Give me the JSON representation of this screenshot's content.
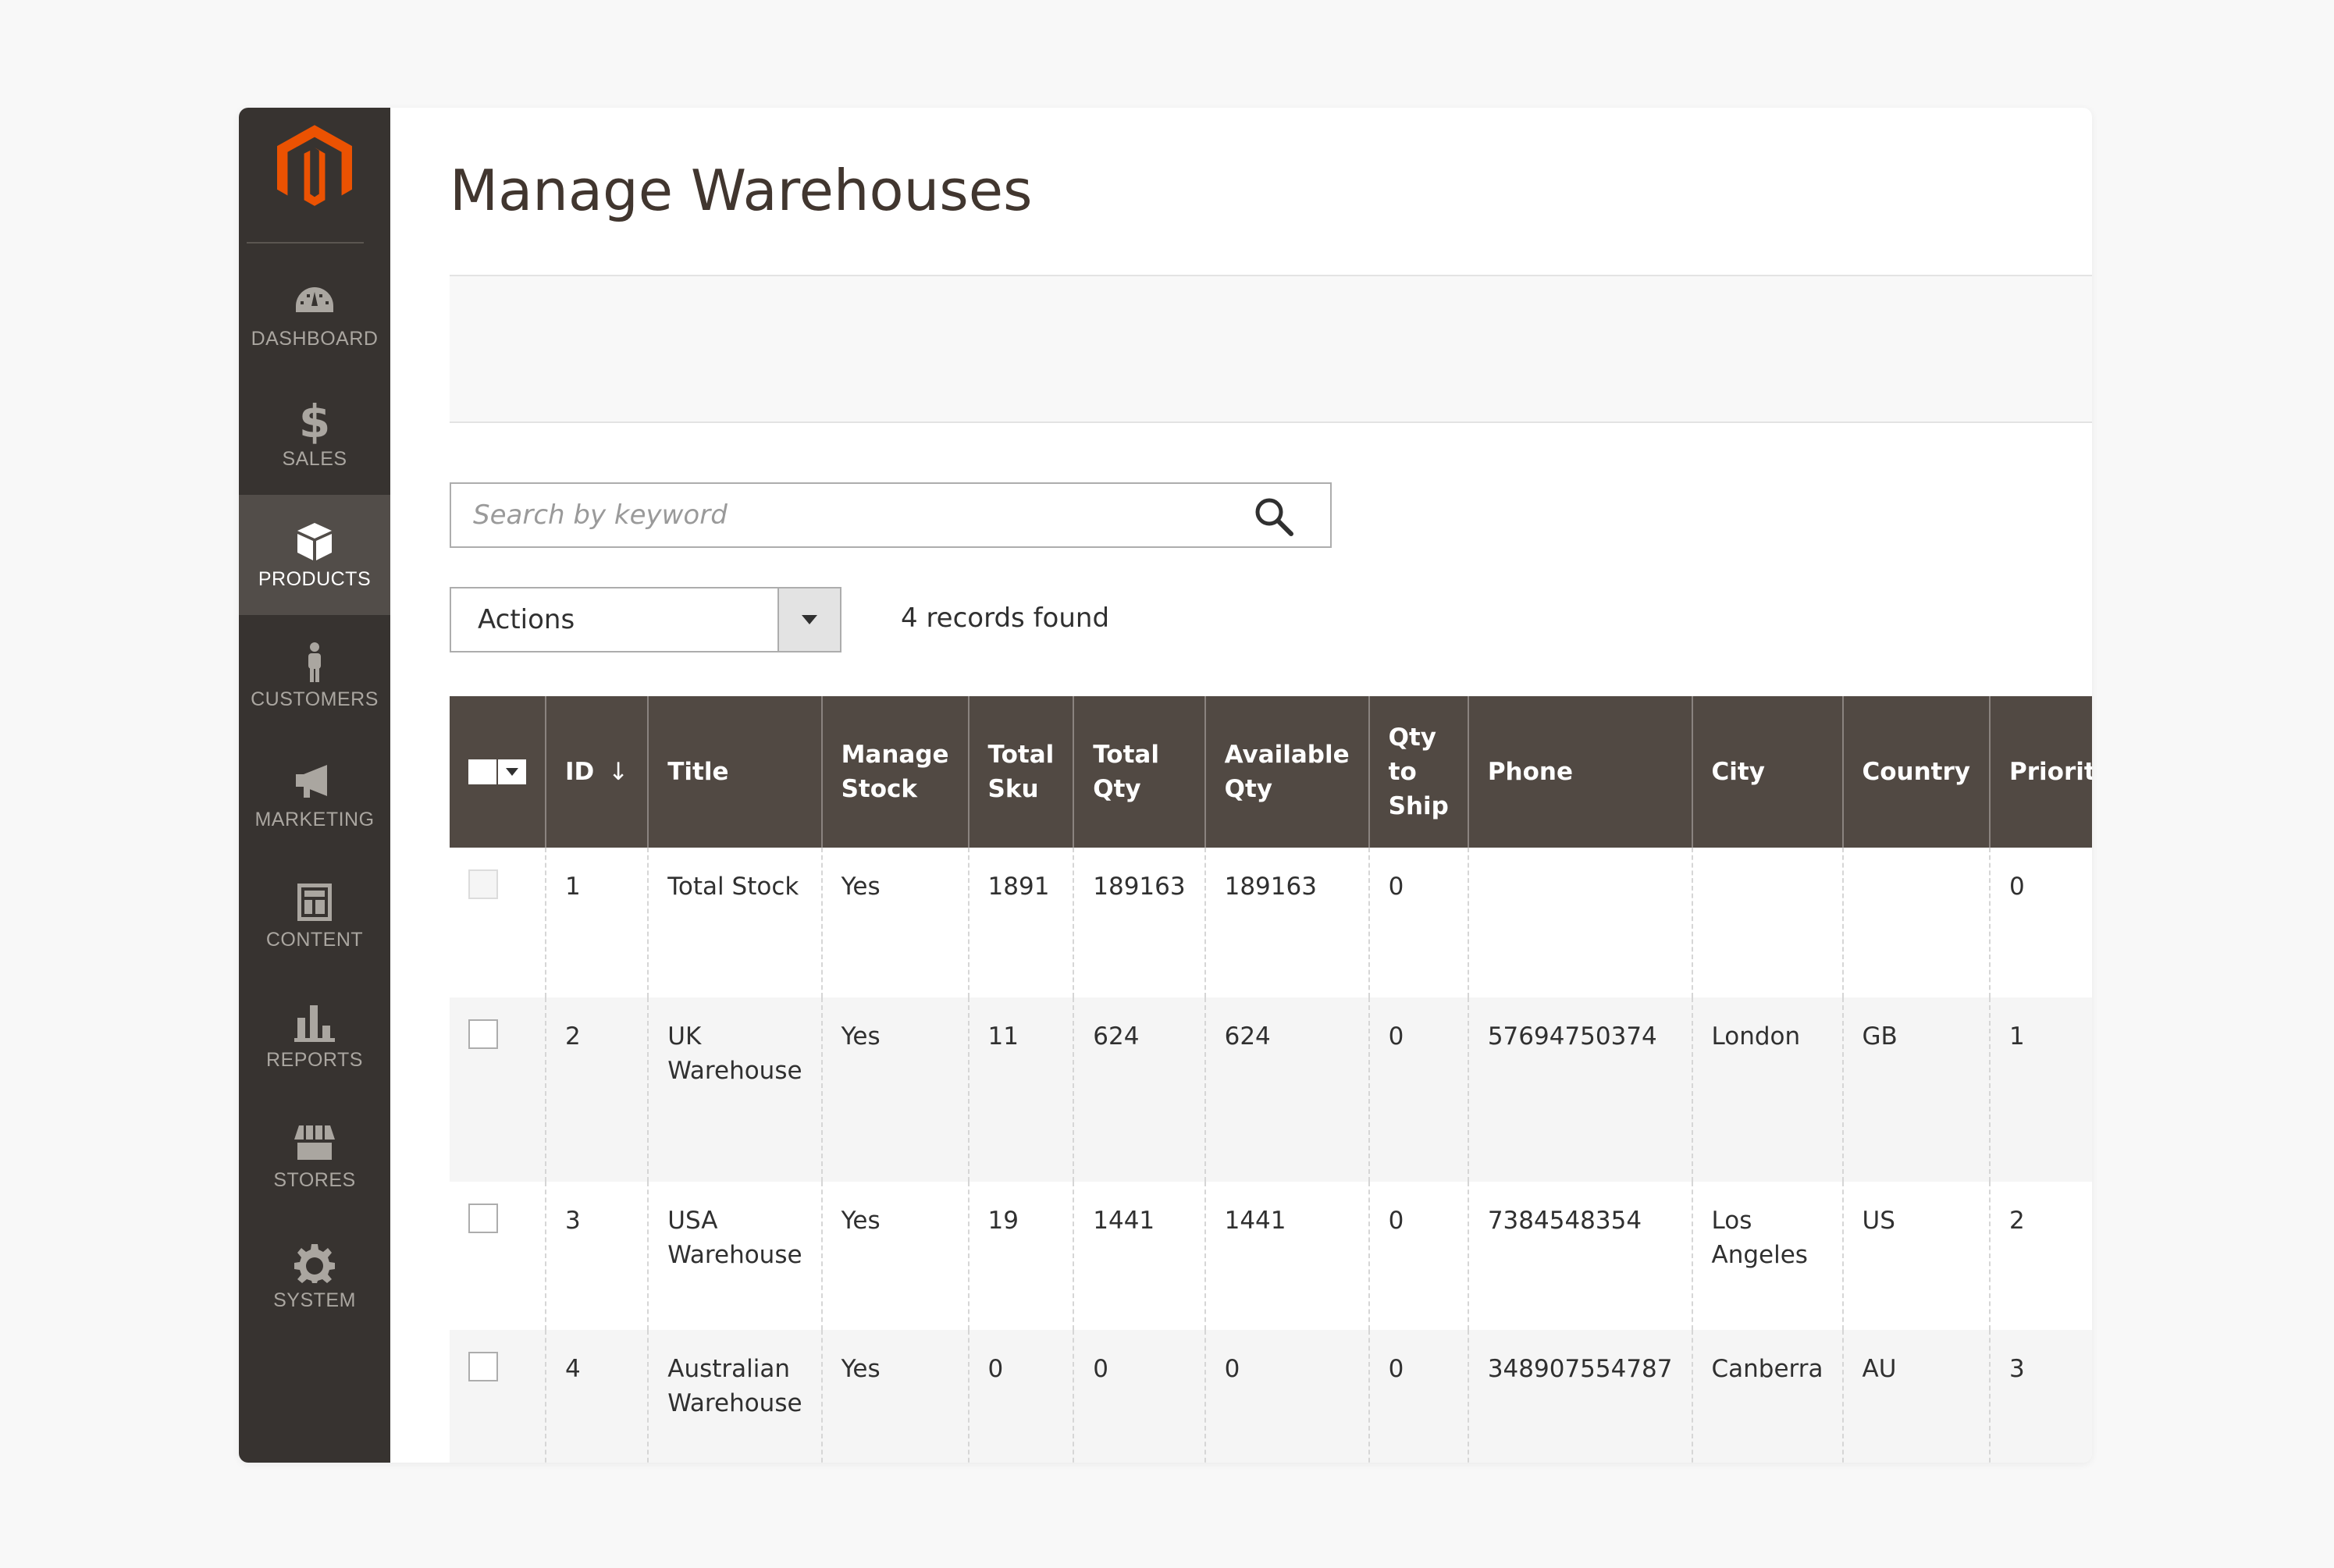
{
  "sidebar": {
    "logo_icon": "magento-logo-icon",
    "items": [
      {
        "label": "DASHBOARD",
        "icon": "dashboard-icon",
        "active": false
      },
      {
        "label": "SALES",
        "icon": "dollar-icon",
        "active": false
      },
      {
        "label": "PRODUCTS",
        "icon": "box-icon",
        "active": true
      },
      {
        "label": "CUSTOMERS",
        "icon": "person-icon",
        "active": false
      },
      {
        "label": "MARKETING",
        "icon": "megaphone-icon",
        "active": false
      },
      {
        "label": "CONTENT",
        "icon": "layout-icon",
        "active": false
      },
      {
        "label": "REPORTS",
        "icon": "bar-chart-icon",
        "active": false
      },
      {
        "label": "STORES",
        "icon": "storefront-icon",
        "active": false
      },
      {
        "label": "SYSTEM",
        "icon": "gear-icon",
        "active": false
      }
    ],
    "dollar_glyph": "$"
  },
  "page": {
    "title": "Manage Warehouses"
  },
  "search": {
    "placeholder": "Search by keyword",
    "value": ""
  },
  "toolbar": {
    "actions_label": "Actions",
    "records_found": "4 records found"
  },
  "grid": {
    "sort_arrow": "↓",
    "columns": [
      {
        "label": ""
      },
      {
        "label": "ID"
      },
      {
        "label": "Title"
      },
      {
        "label": "Manage Stock"
      },
      {
        "label": "Total Sku"
      },
      {
        "label": "Total Qty"
      },
      {
        "label": "Available Qty"
      },
      {
        "label": "Qty to Ship"
      },
      {
        "label": "Phone"
      },
      {
        "label": "City"
      },
      {
        "label": "Country"
      },
      {
        "label": "Priority"
      }
    ],
    "rows": [
      {
        "id": "1",
        "title": "Total Stock",
        "manage_stock": "Yes",
        "total_sku": "1891",
        "total_qty": "189163",
        "available_qty": "189163",
        "qty_to_ship": "0",
        "phone": "",
        "city": "",
        "country": "",
        "priority": "0"
      },
      {
        "id": "2",
        "title": "UK Warehouse",
        "manage_stock": "Yes",
        "total_sku": "11",
        "total_qty": "624",
        "available_qty": "624",
        "qty_to_ship": "0",
        "phone": "57694750374",
        "city": "London",
        "country": "GB",
        "priority": "1"
      },
      {
        "id": "3",
        "title": "USA Warehouse",
        "manage_stock": "Yes",
        "total_sku": "19",
        "total_qty": "1441",
        "available_qty": "1441",
        "qty_to_ship": "0",
        "phone": "7384548354",
        "city": "Los Angeles",
        "country": "US",
        "priority": "2"
      },
      {
        "id": "4",
        "title": "Australian Warehouse",
        "manage_stock": "Yes",
        "total_sku": "0",
        "total_qty": "0",
        "available_qty": "0",
        "qty_to_ship": "0",
        "phone": "348907554787",
        "city": "Canberra",
        "country": "AU",
        "priority": "3"
      }
    ]
  },
  "colors": {
    "sidebar_bg": "#373330",
    "sidebar_active": "#524d49",
    "logo_orange": "#eb5202",
    "grid_header": "#514943"
  }
}
